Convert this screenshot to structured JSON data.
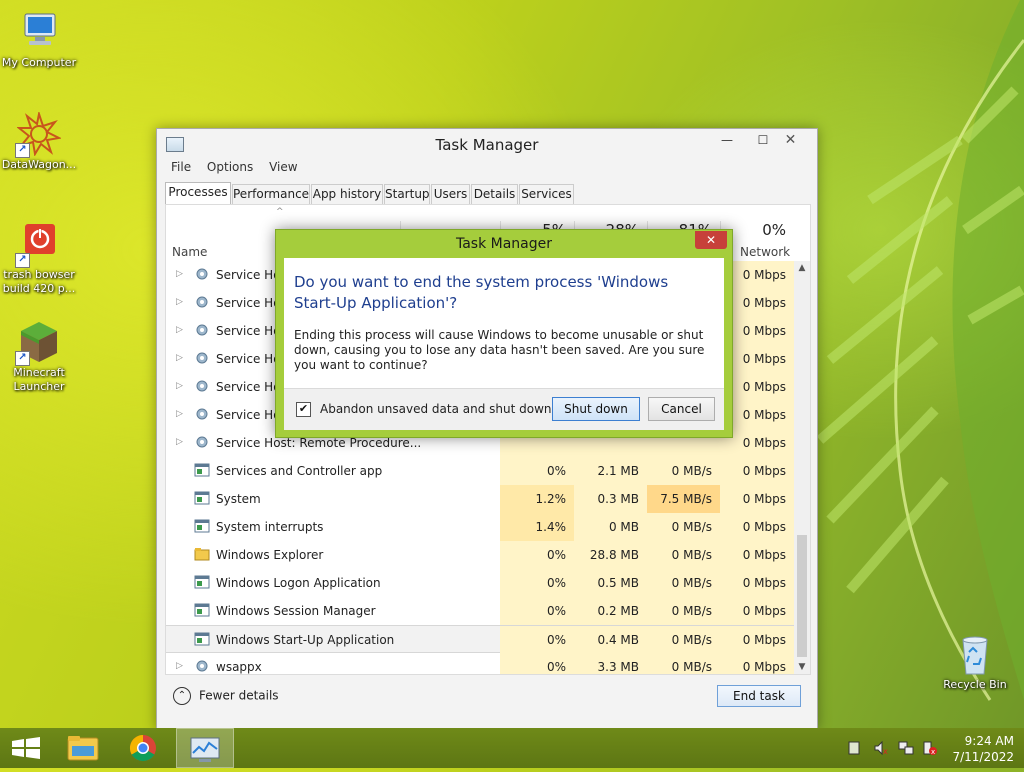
{
  "desktop": {
    "icons": [
      {
        "label": "My Computer"
      },
      {
        "label": "DataWagon..."
      },
      {
        "label": "trash bowser build 420 p..."
      },
      {
        "label": "Minecraft Launcher"
      },
      {
        "label": "Recycle Bin"
      }
    ]
  },
  "task_manager": {
    "title": "Task Manager",
    "menu": [
      "File",
      "Options",
      "View"
    ],
    "tabs": [
      "Processes",
      "Performance",
      "App history",
      "Startup",
      "Users",
      "Details",
      "Services"
    ],
    "active_tab": "Processes",
    "columns": {
      "name": "Name",
      "cpu_pct": "5%",
      "mem_pct": "28%",
      "disk_pct": "81%",
      "net_pct": "0%",
      "network": "Network"
    },
    "rows": [
      {
        "name": "Service Host...",
        "cpu": "",
        "mem": "",
        "disk": "",
        "net": "0 Mbps",
        "expandable": true
      },
      {
        "name": "Service Host...",
        "cpu": "",
        "mem": "",
        "disk": "",
        "net": "0 Mbps",
        "expandable": true
      },
      {
        "name": "Service Host...",
        "cpu": "",
        "mem": "",
        "disk": "",
        "net": "0 Mbps",
        "expandable": true
      },
      {
        "name": "Service Host...",
        "cpu": "",
        "mem": "",
        "disk": "",
        "net": "0 Mbps",
        "expandable": true
      },
      {
        "name": "Service Host...",
        "cpu": "",
        "mem": "",
        "disk": "",
        "net": "0 Mbps",
        "expandable": true
      },
      {
        "name": "Service Host...",
        "cpu": "",
        "mem": "",
        "disk": "",
        "net": "0 Mbps",
        "expandable": true
      },
      {
        "name": "Service Host: Remote Procedure...",
        "cpu": "",
        "mem": "",
        "disk": "",
        "net": "0 Mbps",
        "expandable": true
      },
      {
        "name": "Services and Controller app",
        "cpu": "0%",
        "mem": "2.1 MB",
        "disk": "0 MB/s",
        "net": "0 Mbps",
        "expandable": false
      },
      {
        "name": "System",
        "cpu": "1.2%",
        "mem": "0.3 MB",
        "disk": "7.5 MB/s",
        "net": "0 Mbps",
        "expandable": false
      },
      {
        "name": "System interrupts",
        "cpu": "1.4%",
        "mem": "0 MB",
        "disk": "0 MB/s",
        "net": "0 Mbps",
        "expandable": false
      },
      {
        "name": "Windows Explorer",
        "cpu": "0%",
        "mem": "28.8 MB",
        "disk": "0 MB/s",
        "net": "0 Mbps",
        "expandable": false
      },
      {
        "name": "Windows Logon Application",
        "cpu": "0%",
        "mem": "0.5 MB",
        "disk": "0 MB/s",
        "net": "0 Mbps",
        "expandable": false
      },
      {
        "name": "Windows Session Manager",
        "cpu": "0%",
        "mem": "0.2 MB",
        "disk": "0 MB/s",
        "net": "0 Mbps",
        "expandable": false
      },
      {
        "name": "Windows Start-Up Application",
        "cpu": "0%",
        "mem": "0.4 MB",
        "disk": "0 MB/s",
        "net": "0 Mbps",
        "expandable": false
      },
      {
        "name": "wsappx",
        "cpu": "0%",
        "mem": "3.3 MB",
        "disk": "0 MB/s",
        "net": "0 Mbps",
        "expandable": true
      }
    ],
    "selected_row": "Windows Start-Up Application",
    "fewer_details": "Fewer details",
    "end_task": "End task"
  },
  "dialog": {
    "title": "Task Manager",
    "heading": "Do you want to end the system process 'Windows Start-Up Application'?",
    "body": "Ending this process will cause Windows to become unusable or shut down, causing you to lose any data hasn't been saved. Are you sure you want to continue?",
    "checkbox_label": "Abandon unsaved data and shut down.",
    "checkbox_checked": true,
    "primary_button": "Shut down",
    "secondary_button": "Cancel"
  },
  "taskbar": {
    "time": "9:24 AM",
    "date": "7/11/2022"
  },
  "colors": {
    "dialog_frame": "#a5cd3c",
    "dialog_heading": "#1f3f8f",
    "taskbar": "#6f8a18",
    "close_red": "#c7403a"
  }
}
